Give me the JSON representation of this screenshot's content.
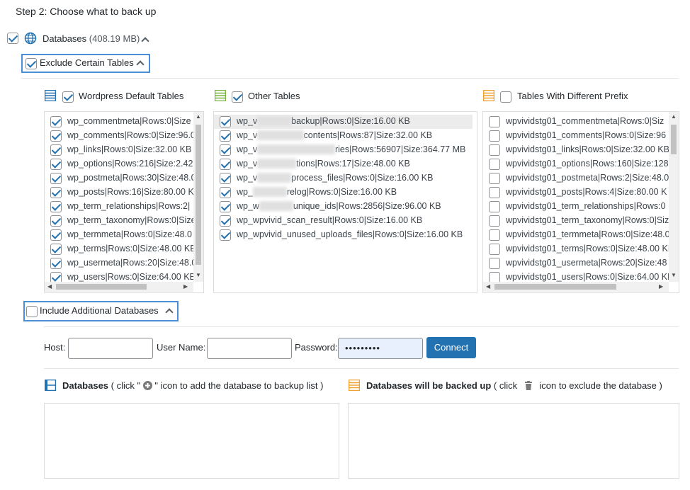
{
  "step_title": "Step 2: Choose what to back up",
  "databases": {
    "label": "Databases",
    "size": "(408.19 MB)",
    "checked": true
  },
  "exclude": {
    "label": "Exclude Certain Tables",
    "checked": true
  },
  "columns": {
    "wordpress": {
      "label": "Wordpress Default Tables",
      "checked": true,
      "icon_color": "#2271b1"
    },
    "other": {
      "label": "Other Tables",
      "checked": true,
      "icon_color": "#7cb342"
    },
    "prefix": {
      "label": "Tables With Different Prefix",
      "checked": false,
      "icon_color": "#f0a030"
    }
  },
  "wordpress_tables": [
    "wp_commentmeta|Rows:0|Size",
    "wp_comments|Rows:0|Size:96.0",
    "wp_links|Rows:0|Size:32.00 KB",
    "wp_options|Rows:216|Size:2.42",
    "wp_postmeta|Rows:30|Size:48.0",
    "wp_posts|Rows:16|Size:80.00 K",
    "wp_term_relationships|Rows:2|",
    "wp_term_taxonomy|Rows:0|Size",
    "wp_termmeta|Rows:0|Size:48.0",
    "wp_terms|Rows:0|Size:48.00 KB",
    "wp_usermeta|Rows:20|Size:48.0",
    "wp_users|Rows:0|Size:64.00 KB"
  ],
  "other_tables": [
    {
      "pre": "wp_v",
      "blur": "wpvivid_",
      "post": "backup|Rows:0|Size:16.00 KB"
    },
    {
      "pre": "wp_v",
      "blur": "wpvivid_me",
      "post": "contents|Rows:87|Size:32.00 KB"
    },
    {
      "pre": "wp_v",
      "blur": "wpvivid_merge_hist",
      "post": "ries|Rows:56907|Size:364.77 MB"
    },
    {
      "pre": "wp_v",
      "blur": "wpvivid_o",
      "post": "tions|Rows:17|Size:48.00 KB"
    },
    {
      "pre": "wp_v",
      "blur": "wpvivid_",
      "post": "process_files|Rows:0|Size:16.00 KB"
    },
    {
      "pre": "wp_",
      "blur": "wpvivid_",
      "post": "relog|Rows:0|Size:16.00 KB"
    },
    {
      "pre": "wp_w",
      "blur": "wpvivid_",
      "post": "unique_ids|Rows:2856|Size:96.00 KB"
    },
    {
      "pre": "",
      "blur": "",
      "post": "wp_wpvivid_scan_result|Rows:0|Size:16.00 KB"
    },
    {
      "pre": "",
      "blur": "",
      "post": "wp_wpvivid_unused_uploads_files|Rows:0|Size:16.00 KB"
    }
  ],
  "prefix_tables": [
    "wpvividstg01_commentmeta|Rows:0|Siz",
    "wpvividstg01_comments|Rows:0|Size:96",
    "wpvividstg01_links|Rows:0|Size:32.00 KB",
    "wpvividstg01_options|Rows:160|Size:128",
    "wpvividstg01_postmeta|Rows:2|Size:48.0",
    "wpvividstg01_posts|Rows:4|Size:80.00 K",
    "wpvividstg01_term_relationships|Rows:0",
    "wpvividstg01_term_taxonomy|Rows:0|Siz",
    "wpvividstg01_termmeta|Rows:0|Size:48.0",
    "wpvividstg01_terms|Rows:0|Size:48.00 KB",
    "wpvividstg01_usermeta|Rows:20|Size:48",
    "wpvividstg01_users|Rows:0|Size:64.00 KE"
  ],
  "include": {
    "label": "Include Additional Databases",
    "checked": false
  },
  "connection": {
    "host_label": "Host:",
    "user_label": "User Name:",
    "password_label": "Password:",
    "password_value": "•••••••••",
    "connect_label": "Connect"
  },
  "db_list": {
    "label": "Databases",
    "hint_pre": "( click \"",
    "hint_post": "\" icon to add the database to backup list )"
  },
  "backed_up": {
    "label": "Databases will be backed up",
    "hint_pre": "( click",
    "hint_post": "icon to exclude the database )"
  }
}
